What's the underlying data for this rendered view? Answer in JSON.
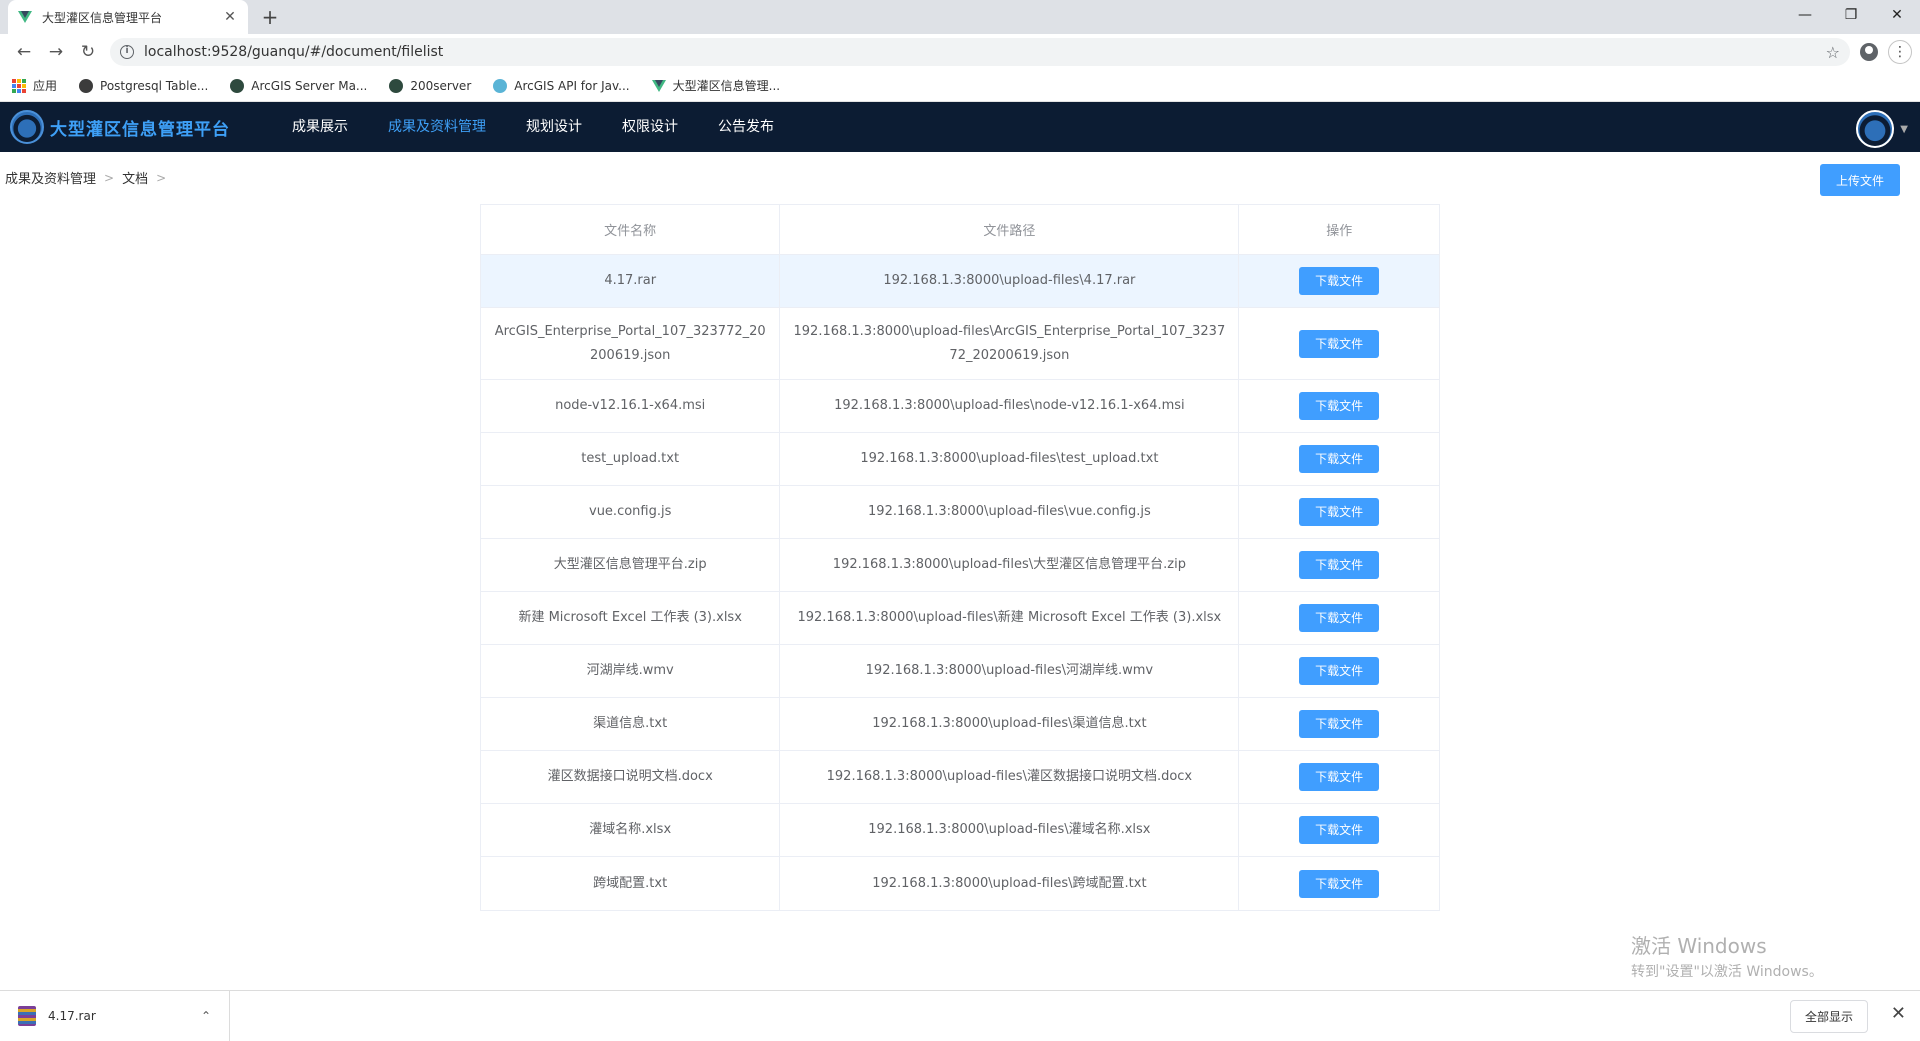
{
  "browser": {
    "tab_title": "大型灌区信息管理平台",
    "tab_close": "✕",
    "new_tab": "+",
    "url": "localhost:9528/guanqu/#/document/filelist",
    "bookmarks": [
      {
        "label": "应用"
      },
      {
        "label": "Postgresql Table..."
      },
      {
        "label": "ArcGIS Server Ma..."
      },
      {
        "label": "200server"
      },
      {
        "label": "ArcGIS API for Jav..."
      },
      {
        "label": "大型灌区信息管理..."
      }
    ]
  },
  "app": {
    "logo_text": "大型灌区信息管理平台",
    "nav": [
      {
        "label": "成果展示",
        "active": false
      },
      {
        "label": "成果及资料管理",
        "active": true
      },
      {
        "label": "规划设计",
        "active": false
      },
      {
        "label": "权限设计",
        "active": false
      },
      {
        "label": "公告发布",
        "active": false
      }
    ],
    "accent_color": "#409eff",
    "header_color": "#0c1c33"
  },
  "breadcrumb": [
    "成果及资料管理",
    "文档"
  ],
  "upload_label": "上传文件",
  "table": {
    "headers": [
      "文件名称",
      "文件路径",
      "操作"
    ],
    "download_label": "下载文件",
    "rows": [
      {
        "name": "4.17.rar",
        "path": "192.168.1.3:8000\\upload-files\\4.17.rar"
      },
      {
        "name": "ArcGIS_Enterprise_Portal_107_323772_20200619.json",
        "path": "192.168.1.3:8000\\upload-files\\ArcGIS_Enterprise_Portal_107_323772_20200619.json"
      },
      {
        "name": "node-v12.16.1-x64.msi",
        "path": "192.168.1.3:8000\\upload-files\\node-v12.16.1-x64.msi"
      },
      {
        "name": "test_upload.txt",
        "path": "192.168.1.3:8000\\upload-files\\test_upload.txt"
      },
      {
        "name": "vue.config.js",
        "path": "192.168.1.3:8000\\upload-files\\vue.config.js"
      },
      {
        "name": "大型灌区信息管理平台.zip",
        "path": "192.168.1.3:8000\\upload-files\\大型灌区信息管理平台.zip"
      },
      {
        "name": "新建 Microsoft Excel 工作表 (3).xlsx",
        "path": "192.168.1.3:8000\\upload-files\\新建 Microsoft Excel 工作表 (3).xlsx"
      },
      {
        "name": "河湖岸线.wmv",
        "path": "192.168.1.3:8000\\upload-files\\河湖岸线.wmv"
      },
      {
        "name": "渠道信息.txt",
        "path": "192.168.1.3:8000\\upload-files\\渠道信息.txt"
      },
      {
        "name": "灌区数据接口说明文档.docx",
        "path": "192.168.1.3:8000\\upload-files\\灌区数据接口说明文档.docx"
      },
      {
        "name": "灌域名称.xlsx",
        "path": "192.168.1.3:8000\\upload-files\\灌域名称.xlsx"
      },
      {
        "name": "跨域配置.txt",
        "path": "192.168.1.3:8000\\upload-files\\跨域配置.txt"
      }
    ]
  },
  "watermark": {
    "line1": "激活 Windows",
    "line2": "转到\"设置\"以激活 Windows。"
  },
  "download_shelf": {
    "file": "4.17.rar",
    "show_all": "全部显示"
  }
}
